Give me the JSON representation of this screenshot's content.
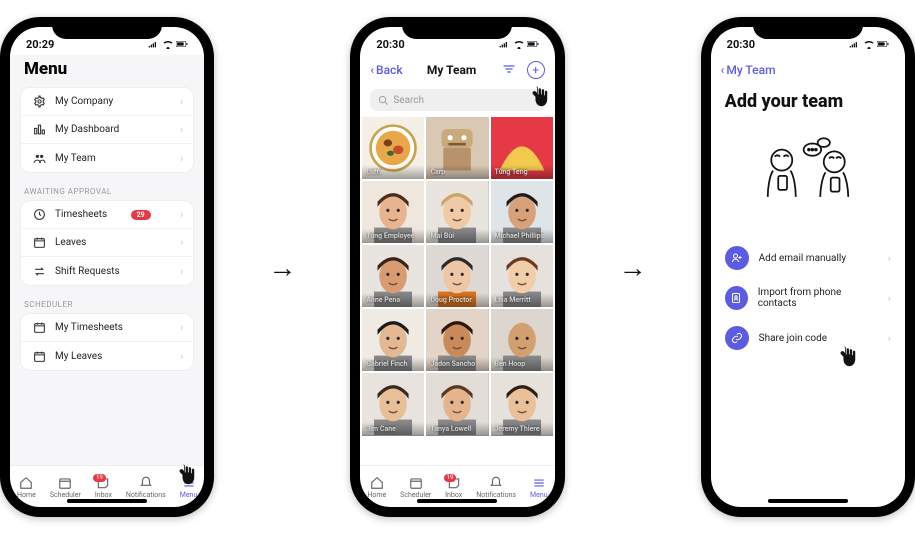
{
  "screen1": {
    "status_time": "20:29",
    "title": "Menu",
    "group1": [
      {
        "icon": "gear",
        "label": "My Company"
      },
      {
        "icon": "dashboard",
        "label": "My Dashboard"
      },
      {
        "icon": "team",
        "label": "My Team"
      }
    ],
    "section_awaiting": "AWAITING APPROVAL",
    "group2": [
      {
        "icon": "timesheet",
        "label": "Timesheets",
        "badge": "29"
      },
      {
        "icon": "calendar",
        "label": "Leaves"
      },
      {
        "icon": "swap",
        "label": "Shift Requests"
      }
    ],
    "section_scheduler": "SCHEDULER",
    "group3": [
      {
        "icon": "calendar",
        "label": "My Timesheets"
      },
      {
        "icon": "calendar",
        "label": "My Leaves"
      }
    ],
    "tabs": {
      "home": "Home",
      "scheduler": "Scheduler",
      "inbox": "Inbox",
      "inbox_badge": "19",
      "notifications": "Notifications",
      "menu": "Menu"
    }
  },
  "screen2": {
    "status_time": "20:30",
    "back": "Back",
    "title": "My Team",
    "search_placeholder": "Search",
    "members": [
      "Luffy",
      "Carp",
      "Tùng Teng",
      "Tung Employee",
      "Mai Bùi",
      "Michael Phillips",
      "Anne Pena",
      "Doug Proctor",
      "Lisa Merritt",
      "Gabriel Finch",
      "Jadon Sancho",
      "Ben Hoop",
      "Jim Cane",
      "Tanya Lowell",
      "Jeremy Thiere"
    ],
    "tabs": {
      "home": "Home",
      "scheduler": "Scheduler",
      "inbox": "Inbox",
      "inbox_badge": "19",
      "notifications": "Notifications",
      "menu": "Menu"
    }
  },
  "screen3": {
    "status_time": "20:30",
    "back": "My Team",
    "title": "Add your team",
    "options": [
      {
        "icon": "user-plus",
        "label": "Add email manually"
      },
      {
        "icon": "contacts",
        "label": "Import from phone contacts"
      },
      {
        "icon": "link",
        "label": "Share join code"
      }
    ]
  }
}
